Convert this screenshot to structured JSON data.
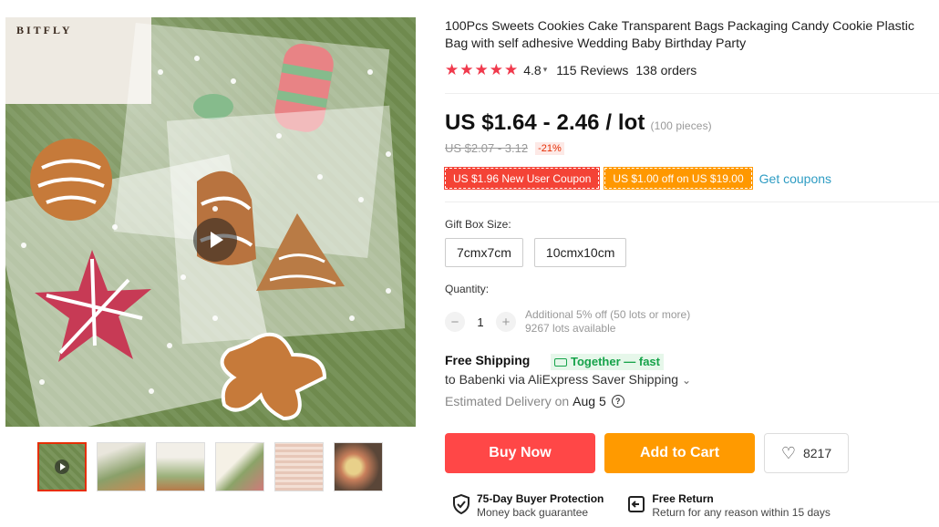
{
  "gallery": {
    "brand_logo": "BITFLY",
    "thumbnails_count": 6
  },
  "product": {
    "title": "100Pcs Sweets Cookies Cake Transparent Bags Packaging Candy Cookie Plastic Bag with self adhesive Wedding Baby Birthday Party",
    "rating": "4.8",
    "rating_value": 4.8,
    "reviews": "115 Reviews",
    "orders": "138 orders"
  },
  "price": {
    "current": "US $1.64 - 2.46 / lot",
    "note": "(100 pieces)",
    "original": "US $2.07 - 3.12",
    "discount": "-21%"
  },
  "coupons": {
    "new_user": "US $1.96 New User Coupon",
    "store": "US $1.00 off on US $19.00",
    "get_link": "Get coupons"
  },
  "sku": {
    "label": "Gift Box Size:",
    "options": [
      "7cmx7cm",
      "10cmx10cm"
    ]
  },
  "quantity": {
    "label": "Quantity:",
    "value": "1",
    "minus": "−",
    "plus": "+",
    "note_line1": "Additional 5% off (50 lots or more)",
    "note_line2": "9267 lots available"
  },
  "shipping": {
    "title": "Free Shipping",
    "badge": "Together — fast",
    "line": "to Babenki via AliExpress Saver Shipping",
    "chevron": "⌄",
    "estimated_label": "Estimated Delivery on",
    "estimated_date": "Aug 5",
    "help": "?"
  },
  "actions": {
    "buy_now": "Buy Now",
    "add_to_cart": "Add to Cart",
    "wishlist_count": "8217"
  },
  "guarantee": {
    "protection_title": "75-Day Buyer Protection",
    "protection_sub": "Money back guarantee",
    "return_title": "Free Return",
    "return_sub": "Return for any reason within 15 days"
  },
  "colors": {
    "star": "#f0394c",
    "buy_now": "#ff4747",
    "add_to_cart": "#ff9a00",
    "link": "#2e9cc3",
    "together": "#16a34a"
  }
}
